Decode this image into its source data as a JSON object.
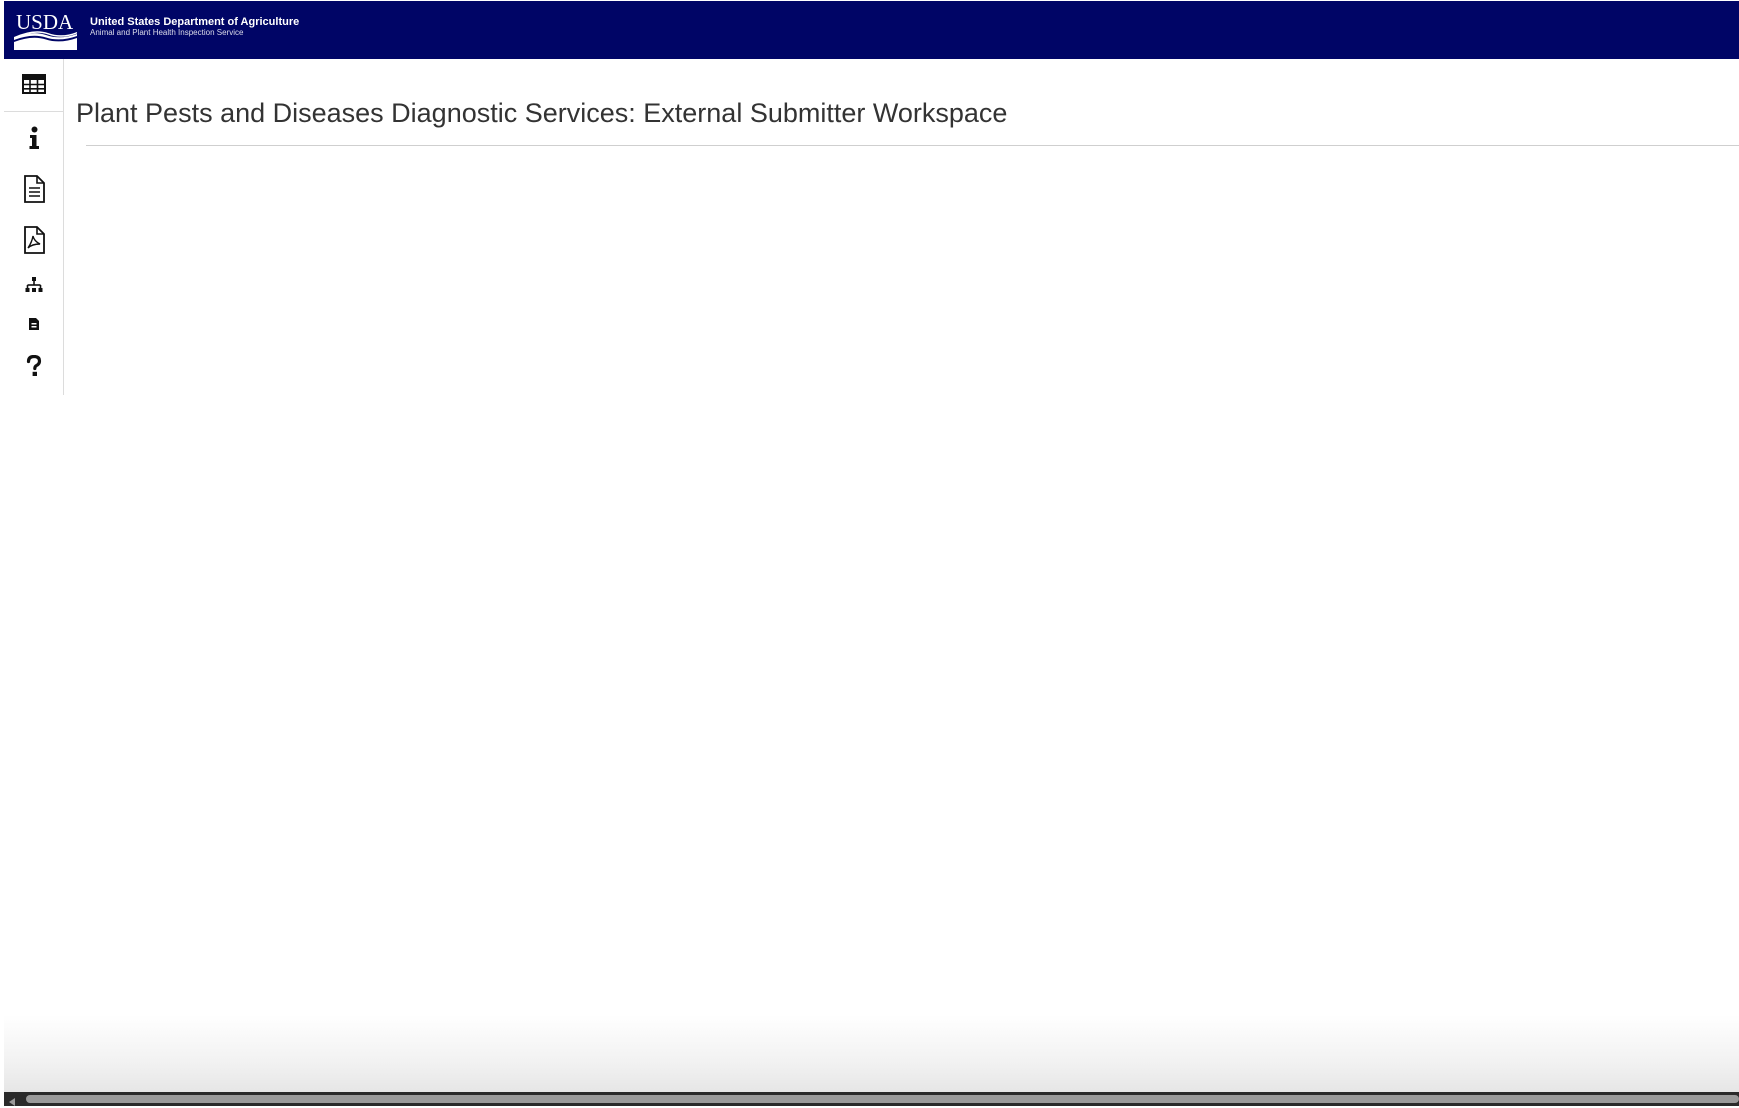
{
  "header": {
    "logo_text": "USDA",
    "agency_name": "United States Department of Agriculture",
    "agency_subname": "Animal and Plant Health Inspection Service",
    "background_color": "#000566"
  },
  "sidebar": {
    "items": [
      {
        "icon": "table-icon"
      },
      {
        "icon": "info-icon"
      },
      {
        "icon": "document-icon"
      },
      {
        "icon": "pdf-icon"
      },
      {
        "icon": "sitemap-icon"
      },
      {
        "icon": "file-badge-icon"
      },
      {
        "icon": "question-icon"
      }
    ]
  },
  "main": {
    "title": "Plant Pests and Diseases Diagnostic Services: External Submitter Workspace"
  },
  "scrollbar": {
    "orientation": "horizontal",
    "arrow_icon": "left-arrow-icon"
  }
}
